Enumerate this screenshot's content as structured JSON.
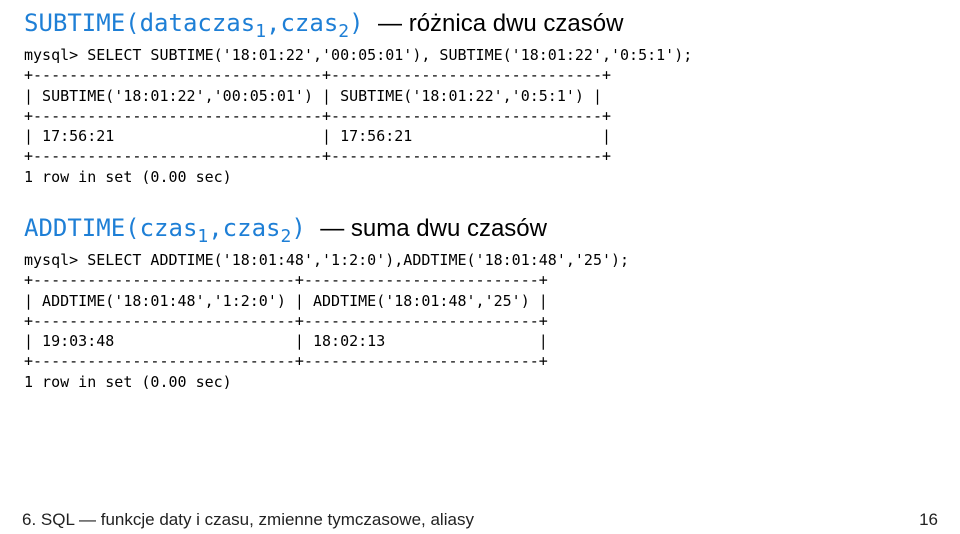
{
  "section1": {
    "sig_name": "SUBTIME(dataczas",
    "sig_sub1": "1",
    "sig_mid": ",czas",
    "sig_sub2": "2",
    "sig_close": ")",
    "desc": " — różnica dwu czasów",
    "terminal": "mysql> SELECT SUBTIME('18:01:22','00:05:01'), SUBTIME('18:01:22','0:5:1');\n+--------------------------------+------------------------------+\n| SUBTIME('18:01:22','00:05:01') | SUBTIME('18:01:22','0:5:1') |\n+--------------------------------+------------------------------+\n| 17:56:21                       | 17:56:21                     |\n+--------------------------------+------------------------------+\n1 row in set (0.00 sec)"
  },
  "section2": {
    "sig_name": "ADDTIME(czas",
    "sig_sub1": "1",
    "sig_mid": ",czas",
    "sig_sub2": "2",
    "sig_close": ")",
    "desc": " — suma dwu czasów",
    "terminal": "mysql> SELECT ADDTIME('18:01:48','1:2:0'),ADDTIME('18:01:48','25');\n+-----------------------------+--------------------------+\n| ADDTIME('18:01:48','1:2:0') | ADDTIME('18:01:48','25') |\n+-----------------------------+--------------------------+\n| 19:03:48                    | 18:02:13                 |\n+-----------------------------+--------------------------+\n1 row in set (0.00 sec)"
  },
  "footer": {
    "left": "6. SQL — funkcje daty i czasu, zmienne tymczasowe, aliasy",
    "right": "16"
  }
}
